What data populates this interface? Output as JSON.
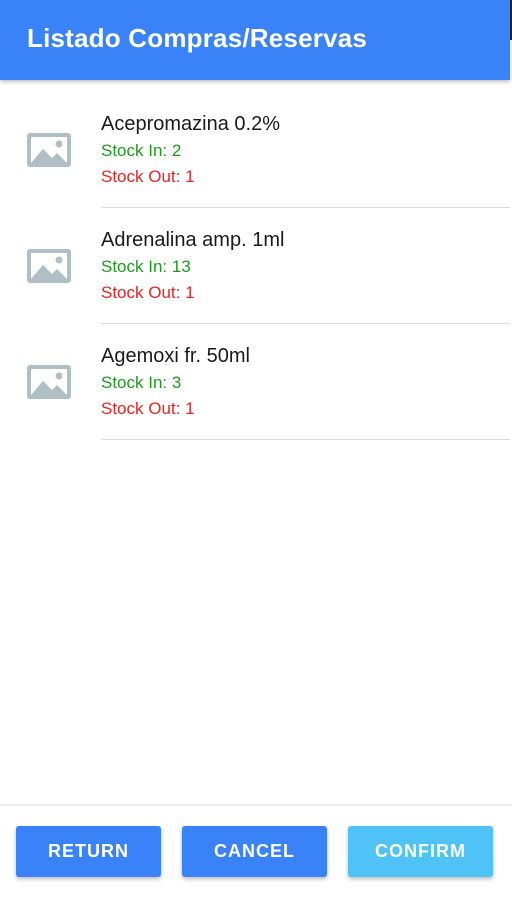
{
  "app_bar": {
    "title": "Listado Compras/Reservas",
    "color": "#3a82f7"
  },
  "items": [
    {
      "icon": "image-placeholder-icon",
      "name": "Acepromazina 0.2%",
      "stock_in": "Stock In: 2",
      "stock_out": "Stock Out: 1"
    },
    {
      "icon": "image-placeholder-icon",
      "name": "Adrenalina amp. 1ml",
      "stock_in": "Stock In: 13",
      "stock_out": "Stock Out: 1"
    },
    {
      "icon": "image-placeholder-icon",
      "name": "Agemoxi fr. 50ml",
      "stock_in": "Stock In: 3",
      "stock_out": "Stock Out: 1"
    }
  ],
  "footer": {
    "return_label": "RETURN",
    "cancel_label": "CANCEL",
    "confirm_label": "CONFIRM"
  },
  "colors": {
    "primary": "#3a82f7",
    "confirm": "#4fc3f7",
    "stock_in": "#1f9a1f",
    "stock_out": "#ee2222",
    "placeholder_icon": "#b0bec5"
  }
}
